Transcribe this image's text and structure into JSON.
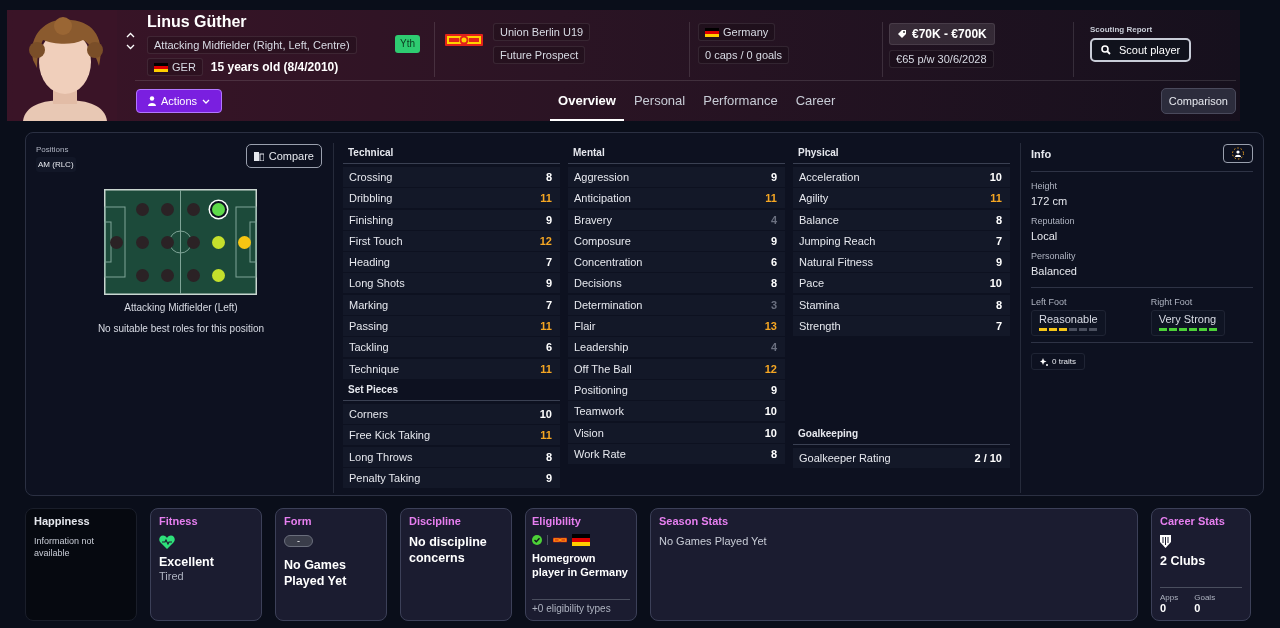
{
  "header": {
    "name": "Linus Güther",
    "position": "Attacking Midfielder (Right, Left, Centre)",
    "nation_code": "GER",
    "age": "15 years old (8/4/2010)",
    "badge": "Yth",
    "club": "Union Berlin U19",
    "status": "Future Prospect",
    "nation": "Germany",
    "caps": "0 caps / 0 goals",
    "value": "€70K - €700K",
    "wage": "€65 p/w 30/6/2028",
    "scouting_label": "Scouting Report",
    "scout_button": "Scout player",
    "actions_button": "Actions",
    "comparison_button": "Comparison"
  },
  "tabs": [
    {
      "label": "Overview",
      "selected": true
    },
    {
      "label": "Personal",
      "selected": false
    },
    {
      "label": "Performance",
      "selected": false
    },
    {
      "label": "Career",
      "selected": false
    }
  ],
  "positions": {
    "label": "Positions",
    "value": "AM (RLC)",
    "compare_button": "Compare",
    "role": "Attacking Midfielder (Left)",
    "note": "No suitable best roles for this position",
    "pitch": [
      {
        "dots": [
          {
            "color": "#2b2225",
            "selected": false
          }
        ]
      },
      {
        "dots": [
          {
            "color": "#2b2225",
            "selected": false
          },
          {
            "color": "#2b2225",
            "selected": false
          },
          {
            "color": "#2b2225",
            "selected": false
          }
        ]
      },
      {
        "dots": [
          {
            "color": "#2b2225",
            "selected": false
          },
          {
            "color": "#2b2225",
            "selected": false
          },
          {
            "color": "#2b2225",
            "selected": false
          }
        ]
      },
      {
        "dots": [
          {
            "color": "#2b2225",
            "selected": false
          },
          {
            "color": "#2b2225",
            "selected": false
          },
          {
            "color": "#2b2225",
            "selected": false
          }
        ]
      },
      {
        "dots": [
          {
            "color": "#5ed94a",
            "selected": true
          },
          {
            "color": "#c5e02c",
            "selected": false
          },
          {
            "color": "#c5e02c",
            "selected": false
          }
        ]
      },
      {
        "dots": [
          {
            "color": "#f7c512",
            "selected": false
          }
        ]
      }
    ]
  },
  "attribute_columns": [
    {
      "groups": [
        {
          "title": "Technical",
          "rows": [
            {
              "name": "Crossing",
              "value": "8",
              "color": "#ffffff"
            },
            {
              "name": "Dribbling",
              "value": "11",
              "color": "#f5a623"
            },
            {
              "name": "Finishing",
              "value": "9",
              "color": "#ffffff"
            },
            {
              "name": "First Touch",
              "value": "12",
              "color": "#f5a623"
            },
            {
              "name": "Heading",
              "value": "7",
              "color": "#ffffff"
            },
            {
              "name": "Long Shots",
              "value": "9",
              "color": "#ffffff"
            },
            {
              "name": "Marking",
              "value": "7",
              "color": "#ffffff"
            },
            {
              "name": "Passing",
              "value": "11",
              "color": "#f5a623"
            },
            {
              "name": "Tackling",
              "value": "6",
              "color": "#ffffff"
            },
            {
              "name": "Technique",
              "value": "11",
              "color": "#f5a623"
            }
          ]
        },
        {
          "title": "Set Pieces",
          "rows": [
            {
              "name": "Corners",
              "value": "10",
              "color": "#ffffff"
            },
            {
              "name": "Free Kick Taking",
              "value": "11",
              "color": "#f5a623"
            },
            {
              "name": "Long Throws",
              "value": "8",
              "color": "#ffffff"
            },
            {
              "name": "Penalty Taking",
              "value": "9",
              "color": "#ffffff"
            }
          ]
        }
      ]
    },
    {
      "groups": [
        {
          "title": "Mental",
          "rows": [
            {
              "name": "Aggression",
              "value": "9",
              "color": "#ffffff"
            },
            {
              "name": "Anticipation",
              "value": "11",
              "color": "#f5a623"
            },
            {
              "name": "Bravery",
              "value": "4",
              "color": "#6b7080"
            },
            {
              "name": "Composure",
              "value": "9",
              "color": "#ffffff"
            },
            {
              "name": "Concentration",
              "value": "6",
              "color": "#ffffff"
            },
            {
              "name": "Decisions",
              "value": "8",
              "color": "#ffffff"
            },
            {
              "name": "Determination",
              "value": "3",
              "color": "#6b7080"
            },
            {
              "name": "Flair",
              "value": "13",
              "color": "#f5a623"
            },
            {
              "name": "Leadership",
              "value": "4",
              "color": "#6b7080"
            },
            {
              "name": "Off The Ball",
              "value": "12",
              "color": "#f5a623"
            },
            {
              "name": "Positioning",
              "value": "9",
              "color": "#ffffff"
            },
            {
              "name": "Teamwork",
              "value": "10",
              "color": "#ffffff"
            },
            {
              "name": "Vision",
              "value": "10",
              "color": "#ffffff"
            },
            {
              "name": "Work Rate",
              "value": "8",
              "color": "#ffffff"
            }
          ]
        }
      ]
    },
    {
      "groups": [
        {
          "title": "Physical",
          "rows": [
            {
              "name": "Acceleration",
              "value": "10",
              "color": "#ffffff"
            },
            {
              "name": "Agility",
              "value": "11",
              "color": "#f5a623"
            },
            {
              "name": "Balance",
              "value": "8",
              "color": "#ffffff"
            },
            {
              "name": "Jumping Reach",
              "value": "7",
              "color": "#ffffff"
            },
            {
              "name": "Natural Fitness",
              "value": "9",
              "color": "#ffffff"
            },
            {
              "name": "Pace",
              "value": "10",
              "color": "#ffffff"
            },
            {
              "name": "Stamina",
              "value": "8",
              "color": "#ffffff"
            },
            {
              "name": "Strength",
              "value": "7",
              "color": "#ffffff"
            }
          ]
        },
        {
          "title": "Goalkeeping",
          "rows": [
            {
              "name": "Goalkeeper Rating",
              "value": "2 / 10",
              "color": "#ffffff"
            }
          ]
        }
      ]
    }
  ],
  "info": {
    "title": "Info",
    "fields": [
      {
        "label": "Height",
        "value": "172 cm"
      },
      {
        "label": "Reputation",
        "value": "Local"
      },
      {
        "label": "Personality",
        "value": "Balanced"
      }
    ],
    "feet": [
      {
        "label": "Left Foot",
        "value": "Reasonable",
        "level": 0.5,
        "color": "#f5c518"
      },
      {
        "label": "Right Foot",
        "value": "Very Strong",
        "level": 1,
        "color": "#4cd137"
      }
    ],
    "traits": "0 traits"
  },
  "cards": [
    {
      "kind": "happiness",
      "title": "Happiness",
      "text": "Information not available"
    },
    {
      "kind": "fitness",
      "title": "Fitness",
      "value": "Excellent",
      "sub": "Tired"
    },
    {
      "kind": "form",
      "title": "Form",
      "chip": "-",
      "value": "No Games Played Yet"
    },
    {
      "kind": "discipline",
      "title": "Discipline",
      "value": "No discipline concerns"
    },
    {
      "kind": "eligibility",
      "title": "Eligibility",
      "value": "Homegrown player in Germany",
      "footer": "+0 eligibility types"
    },
    {
      "kind": "season",
      "title": "Season Stats",
      "text": "No Games Played Yet"
    },
    {
      "kind": "career",
      "title": "Career Stats",
      "value": "2 Clubs",
      "stats": [
        {
          "label": "Apps",
          "value": "0"
        },
        {
          "label": "Goals",
          "value": "0"
        }
      ]
    }
  ]
}
